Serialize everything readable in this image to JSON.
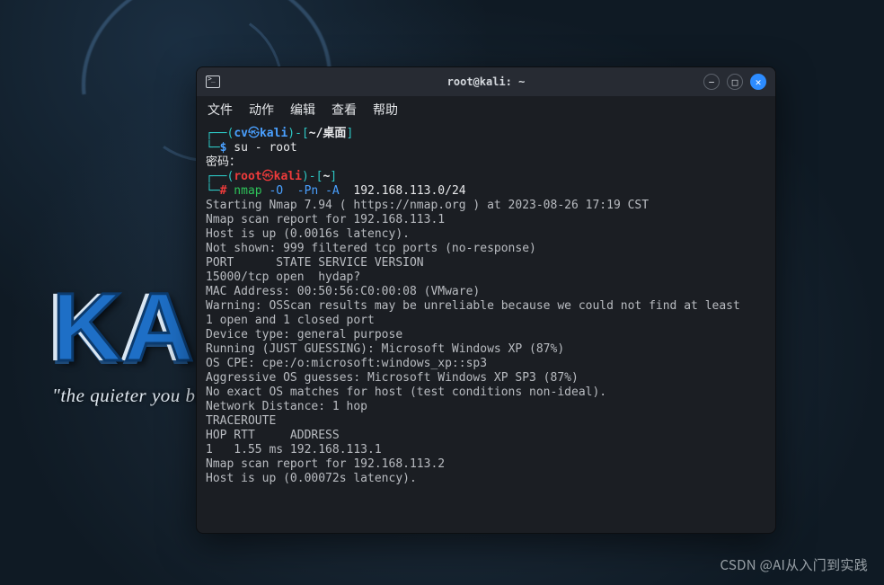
{
  "desktop": {
    "brand_word": "KALI LINUX",
    "tagline": "\"the quieter you become, the more you are able to hear\""
  },
  "terminal": {
    "title": "root@kali: ~",
    "menu": {
      "file": "文件",
      "actions": "动作",
      "edit": "编辑",
      "view": "查看",
      "help": "帮助"
    },
    "win_btns": {
      "minimize": "−",
      "maximize": "□",
      "close": "✕"
    },
    "prompt1": {
      "open": "┌──(",
      "user": "cv",
      "sep": "㉿",
      "host": "kali",
      "close": ")-[",
      "cwd": "~/桌面",
      "end": "]"
    },
    "prompt1_line2": {
      "arm": "└─",
      "sym": "$",
      "cmd": " su - root"
    },
    "password_label": "密码：",
    "prompt2": {
      "open": "┌──(",
      "user": "root",
      "sep": "㉿",
      "host": "kali",
      "close": ")-[",
      "cwd": "~",
      "end": "]"
    },
    "prompt2_line2": {
      "arm": "└─",
      "sym": "#",
      "cmd": " nmap",
      "flag1": " -O ",
      "flag2": " -Pn",
      "space": " ",
      "flag3": "-A ",
      "arg": " 192.168.113.0/24"
    },
    "output": {
      "l01": "Starting Nmap 7.94 ( https://nmap.org ) at 2023-08-26 17:19 CST",
      "l02": "Nmap scan report for 192.168.113.1",
      "l03": "Host is up (0.0016s latency).",
      "l04": "Not shown: 999 filtered tcp ports (no-response)",
      "l05": "PORT      STATE SERVICE VERSION",
      "l06": "15000/tcp open  hydap?",
      "l07": "MAC Address: 00:50:56:C0:00:08 (VMware)",
      "l08": "Warning: OSScan results may be unreliable because we could not find at least",
      "l09": "1 open and 1 closed port",
      "l10": "Device type: general purpose",
      "l11": "Running (JUST GUESSING): Microsoft Windows XP (87%)",
      "l12": "OS CPE: cpe:/o:microsoft:windows_xp::sp3",
      "l13": "Aggressive OS guesses: Microsoft Windows XP SP3 (87%)",
      "l14": "No exact OS matches for host (test conditions non-ideal).",
      "l15": "Network Distance: 1 hop",
      "l16": "",
      "l17": "TRACEROUTE",
      "l18": "HOP RTT     ADDRESS",
      "l19": "1   1.55 ms 192.168.113.1",
      "l20": "",
      "l21": "Nmap scan report for 192.168.113.2",
      "l22": "Host is up (0.00072s latency)."
    }
  },
  "watermark": "CSDN @AI从入门到实践"
}
